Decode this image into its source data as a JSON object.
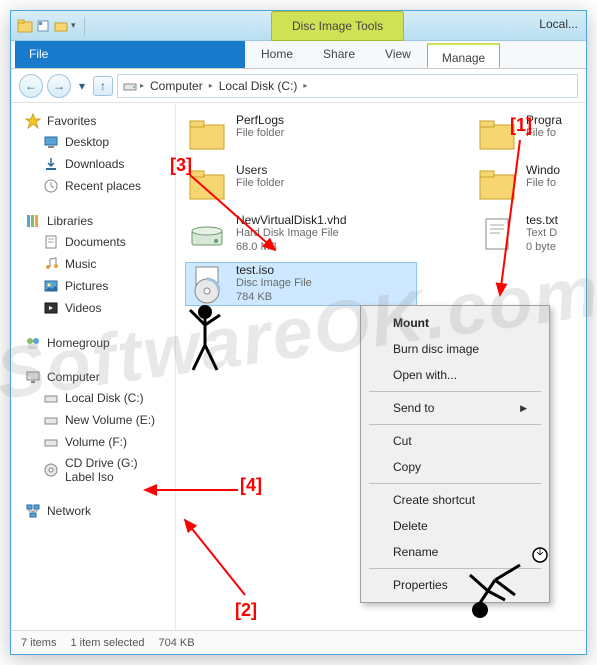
{
  "contextual_tab": "Disc Image Tools",
  "title_location": "Local...",
  "ribbon": {
    "file": "File",
    "home": "Home",
    "share": "Share",
    "view": "View",
    "manage": "Manage"
  },
  "breadcrumb": {
    "seg1": "Computer",
    "seg2": "Local Disk (C:)"
  },
  "sidebar": {
    "favorites": {
      "label": "Favorites",
      "items": [
        "Desktop",
        "Downloads",
        "Recent places"
      ]
    },
    "libraries": {
      "label": "Libraries",
      "items": [
        "Documents",
        "Music",
        "Pictures",
        "Videos"
      ]
    },
    "homegroup": {
      "label": "Homegroup"
    },
    "computer": {
      "label": "Computer",
      "items": [
        "Local Disk (C:)",
        "New Volume (E:)",
        "Volume (F:)",
        "CD Drive (G:) Label Iso"
      ]
    },
    "network": {
      "label": "Network"
    }
  },
  "files": {
    "row1": [
      {
        "name": "PerfLogs",
        "meta": "File folder",
        "type": "folder"
      },
      {
        "name": "Progra",
        "meta": "File fo",
        "type": "folder"
      }
    ],
    "row2": [
      {
        "name": "Users",
        "meta": "File folder",
        "type": "folder"
      },
      {
        "name": "Windo",
        "meta": "File fo",
        "type": "folder"
      }
    ],
    "row3": [
      {
        "name": "NewVirtualDisk1.vhd",
        "meta": "Hard Disk Image File",
        "meta2": "68.0 MB",
        "type": "vhd"
      },
      {
        "name": "tes.txt",
        "meta": "Text D",
        "meta2": "0 byte",
        "type": "txt"
      }
    ],
    "row4": [
      {
        "name": "test.iso",
        "meta": "Disc Image File",
        "meta2": "784 KB",
        "type": "iso",
        "selected": true
      }
    ]
  },
  "context_menu": {
    "mount": "Mount",
    "burn": "Burn disc image",
    "open_with": "Open with...",
    "send_to": "Send to",
    "cut": "Cut",
    "copy": "Copy",
    "shortcut": "Create shortcut",
    "delete": "Delete",
    "rename": "Rename",
    "properties": "Properties"
  },
  "status": {
    "items": "7 items",
    "selected": "1 item selected",
    "size": "704 KB"
  },
  "annotations": {
    "a1": "[1]",
    "a2": "[2]",
    "a3": "[3]",
    "a4": "[4]"
  },
  "watermark": "SoftwareOK.com"
}
